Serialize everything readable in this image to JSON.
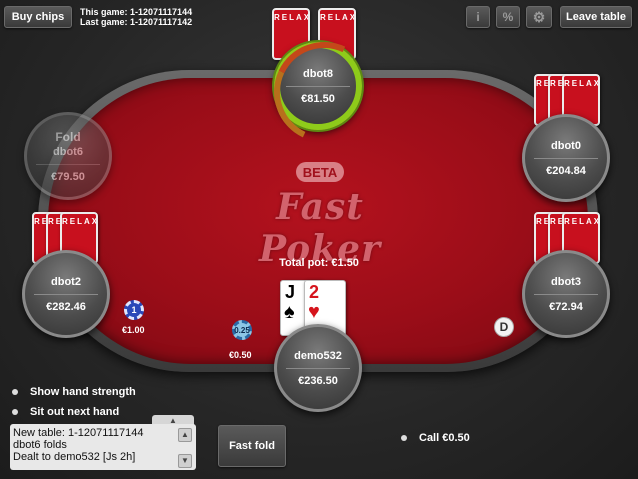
{
  "header": {
    "buy_chips": "Buy chips",
    "this_game": "This game: 1-12071117144",
    "last_game": "Last game: 1-12071117142",
    "info_icon": "i",
    "percent_icon": "%",
    "gear_icon": "⚙",
    "leave_table": "Leave table"
  },
  "table": {
    "beta": "BETA",
    "logo": "Fast Poker",
    "total_pot": "Total pot: €1.50",
    "card_brand": "RELAX"
  },
  "players": {
    "dbot8": {
      "name": "dbot8",
      "stack": "€81.50"
    },
    "dbot6": {
      "name": "dbot6",
      "stack": "€79.50",
      "status": "Fold"
    },
    "dbot0": {
      "name": "dbot0",
      "stack": "€204.84"
    },
    "dbot2": {
      "name": "dbot2",
      "stack": "€282.46",
      "chip": "1",
      "bet": "€1.00"
    },
    "dbot3": {
      "name": "dbot3",
      "stack": "€72.94"
    },
    "demo532": {
      "name": "demo532",
      "stack": "€236.50",
      "chip": "0.25",
      "bet": "€0.50"
    }
  },
  "hero_cards": [
    {
      "rank": "J",
      "suit": "♠"
    },
    {
      "rank": "2",
      "suit": "♥"
    }
  ],
  "dealer_button": "D",
  "options": {
    "show_hand_strength": "Show hand strength",
    "sit_out_next_hand": "Sit out next hand"
  },
  "chat": {
    "lines": [
      "New table: 1-12071117144",
      "dbot6 folds",
      "Dealt to demo532 [Js 2h]"
    ]
  },
  "actions": {
    "fast_fold": "Fast fold",
    "call": "Call €0.50"
  },
  "colors": {
    "felt": "#9a0d18",
    "timer_green": "#8ecb1a",
    "card_back": "#c8101e"
  }
}
